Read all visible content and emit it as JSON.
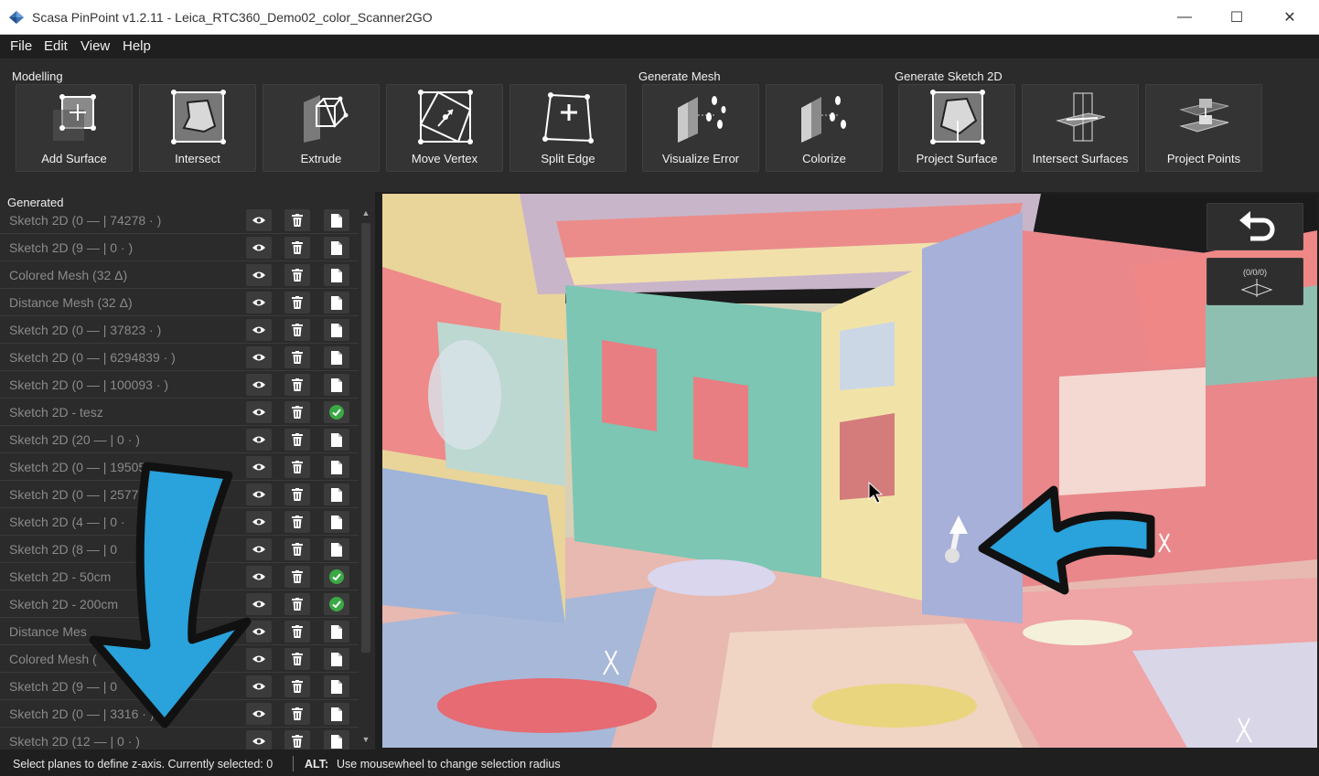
{
  "window": {
    "title": "Scasa PinPoint v1.2.11 - Leica_RTC360_Demo02_color_Scanner2GO",
    "minimize_glyph": "—",
    "maximize_glyph": "☐",
    "close_glyph": "✕"
  },
  "menu": [
    "File",
    "Edit",
    "View",
    "Help"
  ],
  "toolbar": {
    "groups": [
      "Modelling",
      "Generate Mesh",
      "Generate Sketch 2D"
    ],
    "buttons": [
      {
        "label": "Add Surface",
        "icon": "add-surface-icon"
      },
      {
        "label": "Intersect",
        "icon": "intersect-icon"
      },
      {
        "label": "Extrude",
        "icon": "extrude-icon"
      },
      {
        "label": "Move Vertex",
        "icon": "move-vertex-icon"
      },
      {
        "label": "Split Edge",
        "icon": "split-edge-icon"
      },
      {
        "label": "Visualize Error",
        "icon": "visualize-error-icon"
      },
      {
        "label": "Colorize",
        "icon": "colorize-icon"
      },
      {
        "label": "Project Surface",
        "icon": "project-surface-icon"
      },
      {
        "label": "Intersect Surfaces",
        "icon": "intersect-surfaces-icon"
      },
      {
        "label": "Project Points",
        "icon": "project-points-icon"
      }
    ]
  },
  "panel": {
    "title": "Generated",
    "items": [
      {
        "name": "Sketch 2D (0 — | 74278 · )",
        "exported": false
      },
      {
        "name": "Sketch 2D (9 — | 0 · )",
        "exported": false
      },
      {
        "name": "Colored Mesh (32 Δ)",
        "exported": false
      },
      {
        "name": "Distance Mesh (32 Δ)",
        "exported": false
      },
      {
        "name": "Sketch 2D (0 — | 37823 · )",
        "exported": false
      },
      {
        "name": "Sketch 2D (0 — | 6294839 · )",
        "exported": false
      },
      {
        "name": "Sketch 2D (0 — | 100093 · )",
        "exported": false
      },
      {
        "name": "Sketch 2D - tesz",
        "exported": true
      },
      {
        "name": "Sketch 2D (20 — | 0 · )",
        "exported": false
      },
      {
        "name": "Sketch 2D (0 — | 195056",
        "exported": false
      },
      {
        "name": "Sketch 2D (0 — | 2577",
        "exported": false
      },
      {
        "name": "Sketch 2D (4 — | 0 ·",
        "exported": false
      },
      {
        "name": "Sketch 2D (8 — | 0",
        "exported": false
      },
      {
        "name": "Sketch 2D - 50cm",
        "exported": true
      },
      {
        "name": "Sketch 2D - 200cm",
        "exported": true
      },
      {
        "name": "Distance Mes",
        "exported": false
      },
      {
        "name": "Colored Mesh (",
        "exported": false
      },
      {
        "name": "Sketch 2D (9 — | 0",
        "exported": false
      },
      {
        "name": "Sketch 2D (0 — | 3316 · )",
        "exported": false
      },
      {
        "name": "Sketch 2D (12 — | 0 · )",
        "exported": false
      }
    ]
  },
  "viewport": {
    "coord_label": "(0/0/0)"
  },
  "status": {
    "left": "Select planes to define z-axis. Currently selected: 0",
    "key": "ALT:",
    "hint": "Use mousewheel to change selection radius"
  },
  "colors": {
    "accent_arrow": "#2aa2dc",
    "check_green": "#3aa845",
    "panel_bg": "#2b2b2b"
  }
}
